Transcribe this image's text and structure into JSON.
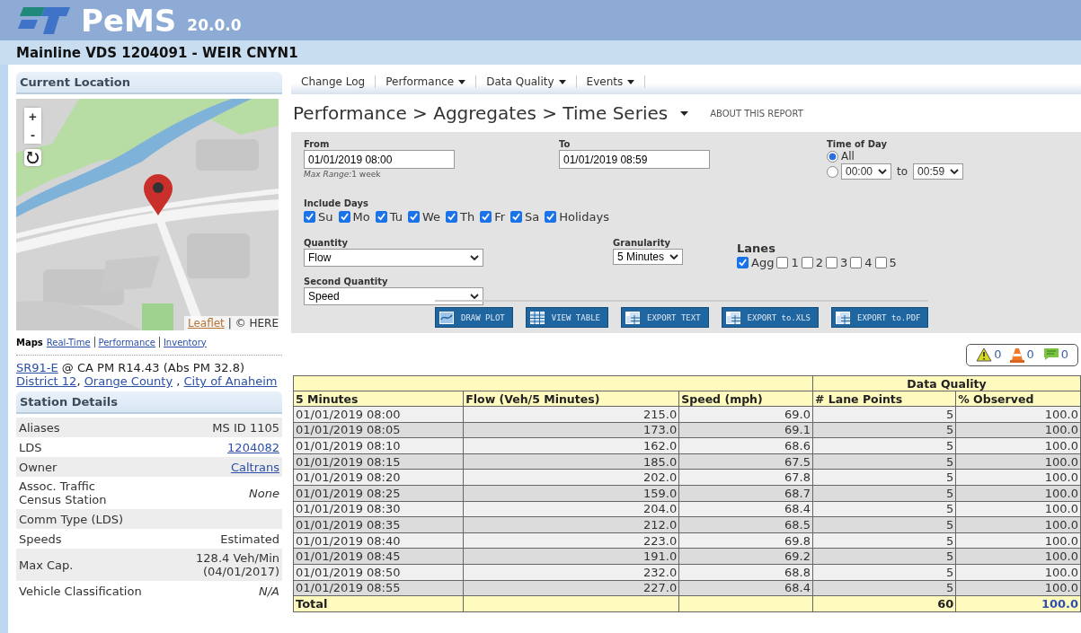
{
  "header": {
    "logo": "PeMS",
    "version": "20.0.0"
  },
  "page_title": "Mainline VDS 1204091 - WEIR CNYN1",
  "sidebar": {
    "location_title": "Current Location",
    "map": {
      "kind": "picture",
      "zoom_in": "+",
      "zoom_out": "-",
      "attribution_link": "Leaflet",
      "attribution_text": "| © HERE"
    },
    "maps_label": "Maps",
    "maps_links": [
      "Real-Time",
      "Performance",
      "Inventory"
    ],
    "location": [
      {
        "kind": "link",
        "text": "SR91-E"
      },
      {
        "kind": "text",
        "text": " @ CA PM R14.43 (Abs PM 32.8) "
      },
      {
        "kind": "link",
        "text": "District 12"
      },
      {
        "kind": "text",
        "text": ",  "
      },
      {
        "kind": "link",
        "text": "Orange County"
      },
      {
        "kind": "text",
        "text": " , "
      },
      {
        "kind": "link",
        "text": "City of Anaheim"
      }
    ],
    "details_title": "Station Details",
    "details": [
      {
        "label": "Aliases",
        "value": "MS ID 1105",
        "kind": "text"
      },
      {
        "label": "LDS",
        "value": "1204082",
        "kind": "link"
      },
      {
        "label": "Owner",
        "value": "Caltrans",
        "kind": "link"
      },
      {
        "label": "Assoc. Traffic Census Station",
        "value": "None",
        "kind": "italic"
      },
      {
        "label": "Comm Type (LDS)"
      },
      {
        "label": "Speeds",
        "value": "Estimated",
        "kind": "text"
      },
      {
        "label": "Max Cap.",
        "value": "128.4 Veh/Min (04/01/2017)",
        "kind": "text"
      },
      {
        "label": "Vehicle Classification",
        "value": "N/A",
        "kind": "italic"
      }
    ]
  },
  "nav": [
    {
      "label": "Change Log",
      "dropdown": false
    },
    {
      "label": "Performance",
      "dropdown": true
    },
    {
      "label": "Data Quality",
      "dropdown": true
    },
    {
      "label": "Events",
      "dropdown": true
    }
  ],
  "report": {
    "breadcrumb": "Performance > Aggregates > Time Series",
    "about": "ABOUT THIS REPORT"
  },
  "form": {
    "from": {
      "label": "From",
      "value": "01/01/2019 08:00",
      "hint_label": "Max Range:",
      "hint": "1 week"
    },
    "to": {
      "label": "To",
      "value": "01/01/2019 08:59"
    },
    "time_of_day": {
      "label": "Time of Day",
      "all": {
        "label": "All",
        "selected": true
      },
      "range": {
        "selected": false,
        "from": "00:00",
        "joiner": "to",
        "to": "00:59"
      }
    },
    "include_days": {
      "label": "Include Days",
      "days": [
        {
          "label": "Su",
          "checked": true
        },
        {
          "label": "Mo",
          "checked": true
        },
        {
          "label": "Tu",
          "checked": true
        },
        {
          "label": "We",
          "checked": true
        },
        {
          "label": "Th",
          "checked": true
        },
        {
          "label": "Fr",
          "checked": true
        },
        {
          "label": "Sa",
          "checked": true
        },
        {
          "label": "Holidays",
          "checked": true
        }
      ]
    },
    "quantity": {
      "label": "Quantity",
      "value": "Flow"
    },
    "second_quantity": {
      "label": "Second Quantity",
      "value": "Speed"
    },
    "granularity": {
      "label": "Granularity",
      "value": "5 Minutes"
    },
    "lanes": {
      "label": "Lanes",
      "items": [
        {
          "label": "Agg",
          "checked": true
        },
        {
          "label": "1",
          "checked": false
        },
        {
          "label": "2",
          "checked": false
        },
        {
          "label": "3",
          "checked": false
        },
        {
          "label": "4",
          "checked": false
        },
        {
          "label": "5",
          "checked": false
        }
      ]
    }
  },
  "buttons": [
    {
      "label": "DRAW PLOT",
      "kind": "plot"
    },
    {
      "label": "VIEW TABLE",
      "kind": "table"
    },
    {
      "label": "EXPORT TEXT",
      "kind": "export"
    },
    {
      "label": "EXPORT to.XLS",
      "kind": "export"
    },
    {
      "label": "EXPORT to.PDF",
      "kind": "export"
    }
  ],
  "alerts": [
    {
      "kind": "warning",
      "count": "0"
    },
    {
      "kind": "cone",
      "count": "0"
    },
    {
      "kind": "message",
      "count": "0"
    }
  ],
  "table": {
    "group_header": "Data Quality",
    "columns": [
      "5 Minutes",
      "Flow (Veh/5 Minutes)",
      "Speed (mph)",
      "# Lane Points",
      "% Observed"
    ],
    "rows": [
      [
        "01/01/2019 08:00",
        "215.0",
        "69.0",
        "5",
        "100.0"
      ],
      [
        "01/01/2019 08:05",
        "173.0",
        "69.1",
        "5",
        "100.0"
      ],
      [
        "01/01/2019 08:10",
        "162.0",
        "68.6",
        "5",
        "100.0"
      ],
      [
        "01/01/2019 08:15",
        "185.0",
        "67.5",
        "5",
        "100.0"
      ],
      [
        "01/01/2019 08:20",
        "202.0",
        "67.8",
        "5",
        "100.0"
      ],
      [
        "01/01/2019 08:25",
        "159.0",
        "68.7",
        "5",
        "100.0"
      ],
      [
        "01/01/2019 08:30",
        "204.0",
        "68.4",
        "5",
        "100.0"
      ],
      [
        "01/01/2019 08:35",
        "212.0",
        "68.5",
        "5",
        "100.0"
      ],
      [
        "01/01/2019 08:40",
        "223.0",
        "69.8",
        "5",
        "100.0"
      ],
      [
        "01/01/2019 08:45",
        "191.0",
        "69.2",
        "5",
        "100.0"
      ],
      [
        "01/01/2019 08:50",
        "232.0",
        "68.8",
        "5",
        "100.0"
      ],
      [
        "01/01/2019 08:55",
        "227.0",
        "68.4",
        "5",
        "100.0"
      ]
    ],
    "total": {
      "label": "Total",
      "lane_points": "60",
      "observed": "100.0"
    }
  }
}
